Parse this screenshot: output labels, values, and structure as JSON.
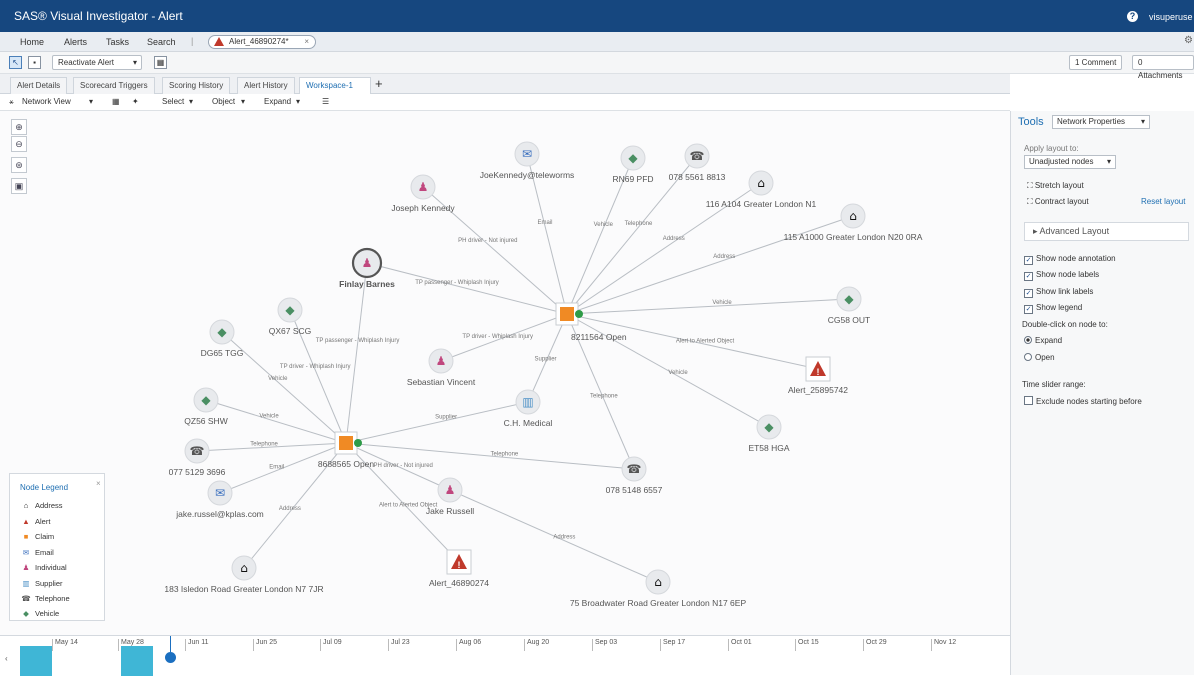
{
  "window": {
    "title": "SAS® Visual Investigator - Alert",
    "user": "visuperuse"
  },
  "menu": {
    "items": [
      "Home",
      "Alerts",
      "Tasks",
      "Search"
    ],
    "open_tab": "Alert_46890274*"
  },
  "toolbar": {
    "reactivate_label": "Reactivate Alert"
  },
  "right_top": {
    "comment_label": "1 Comment",
    "attachments_label": "0 Attachments"
  },
  "tabs": [
    "Alert Details",
    "Scorecard Triggers",
    "Scoring History",
    "Alert History",
    "Workspace-1"
  ],
  "active_tab": "Workspace-1",
  "network_toolbar": {
    "view_label": "Network View",
    "select_label": "Select",
    "object_label": "Object",
    "expand_label": "Expand"
  },
  "colors": {
    "header": "#16477f",
    "individual": "#c0477e",
    "vehicle": "#4a8f63",
    "email": "#3a6fbe",
    "supplier": "#4e92c7",
    "claim": "#f08a24",
    "alert": "#c0392b",
    "address": "#111111",
    "telephone": "#555555"
  },
  "nodes": [
    {
      "label": "JoeKennedy@teleworms",
      "type": "email"
    },
    {
      "label": "RN69 PFD",
      "type": "vehicle"
    },
    {
      "label": "078 5561 8813",
      "type": "telephone"
    },
    {
      "label": "116 A104 Greater London N1",
      "type": "address"
    },
    {
      "label": "115 A1000 Greater London N20 0RA",
      "type": "address"
    },
    {
      "label": "Joseph Kennedy",
      "type": "individual"
    },
    {
      "label": "Finlay Barnes",
      "type": "individual"
    },
    {
      "label": "8211564 Open",
      "type": "claim"
    },
    {
      "label": "CG58 OUT",
      "type": "vehicle"
    },
    {
      "label": "QX67 SCG",
      "type": "vehicle"
    },
    {
      "label": "DG65 TGG",
      "type": "vehicle"
    },
    {
      "label": "Sebastian Vincent",
      "type": "individual"
    },
    {
      "label": "Alert_25895742",
      "type": "alert"
    },
    {
      "label": "QZ56 SHW",
      "type": "vehicle"
    },
    {
      "label": "C.H. Medical",
      "type": "supplier"
    },
    {
      "label": "ET58 HGA",
      "type": "vehicle"
    },
    {
      "label": "077 5129 3696",
      "type": "telephone"
    },
    {
      "label": "8688565 Open",
      "type": "claim"
    },
    {
      "label": "078 5148 6557",
      "type": "telephone"
    },
    {
      "label": "jake.russel@kplas.com",
      "type": "email"
    },
    {
      "label": "Jake Russell",
      "type": "individual"
    },
    {
      "label": "Alert_46890274",
      "type": "alert"
    },
    {
      "label": "183 Isledon Road Greater London N7 7JR",
      "type": "address"
    },
    {
      "label": "75 Broadwater Road Greater London N17 6EP",
      "type": "address"
    }
  ],
  "links": [
    {
      "label": "Email"
    },
    {
      "label": "Vehicle"
    },
    {
      "label": "Telephone"
    },
    {
      "label": "Address"
    },
    {
      "label": "Address"
    },
    {
      "label": "PH driver - Not injured"
    },
    {
      "label": "TP passenger - Whiplash Injury"
    },
    {
      "label": "Vehicle"
    },
    {
      "label": "TP driver - Whiplash Injury"
    },
    {
      "label": "Alert to Alerted Object"
    },
    {
      "label": "Vehicle"
    },
    {
      "label": "Supplier"
    },
    {
      "label": "Telephone"
    },
    {
      "label": "TP driver - Whiplash Injury"
    },
    {
      "label": "Vehicle"
    },
    {
      "label": "TP passenger - Whiplash Injury"
    },
    {
      "label": "Vehicle"
    },
    {
      "label": "Supplier"
    },
    {
      "label": "Telephone"
    },
    {
      "label": "Email"
    },
    {
      "label": "PH driver - Not injured"
    },
    {
      "label": "Telephone"
    },
    {
      "label": "Alert to Alerted Object"
    },
    {
      "label": "Address"
    },
    {
      "label": "Address"
    }
  ],
  "legend": {
    "title": "Node Legend",
    "items": [
      "Address",
      "Alert",
      "Claim",
      "Email",
      "Individual",
      "Supplier",
      "Telephone",
      "Vehicle"
    ]
  },
  "timeline": {
    "ticks": [
      "May 14",
      "May 28",
      "Jun 11",
      "Jun 25",
      "Jul 09",
      "Jul 23",
      "Aug 06",
      "Aug 20",
      "Sep 03",
      "Sep 17",
      "Oct 01",
      "Oct 15",
      "Oct 29",
      "Nov 12"
    ]
  },
  "tools": {
    "title": "Tools",
    "dropdown": "Network Properties",
    "apply_layout_label": "Apply layout to:",
    "apply_layout_value": "Unadjusted nodes",
    "stretch": "Stretch layout",
    "contract": "Contract layout",
    "reset": "Reset layout",
    "advanced": "Advanced Layout",
    "checkboxes": [
      {
        "label": "Show node annotation",
        "checked": true
      },
      {
        "label": "Show node labels",
        "checked": true
      },
      {
        "label": "Show link labels",
        "checked": true
      },
      {
        "label": "Show legend",
        "checked": true
      }
    ],
    "dblclick_label": "Double-click on node to:",
    "radio": [
      {
        "label": "Expand",
        "selected": true
      },
      {
        "label": "Open",
        "selected": false
      }
    ],
    "slider_label": "Time slider range:",
    "exclude_label": "Exclude nodes starting before",
    "exclude_checked": false
  }
}
